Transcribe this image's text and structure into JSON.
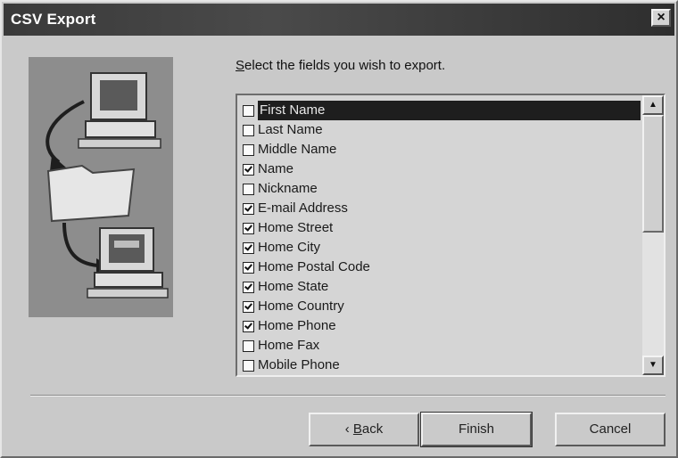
{
  "window": {
    "title": "CSV Export",
    "close_glyph": "×"
  },
  "instruction": {
    "prefix": "",
    "accel": "S",
    "rest": "elect the fields you wish to export."
  },
  "fields": [
    {
      "label": "First Name",
      "checked": false,
      "selected": true
    },
    {
      "label": "Last Name",
      "checked": false,
      "selected": false
    },
    {
      "label": "Middle Name",
      "checked": false,
      "selected": false
    },
    {
      "label": "Name",
      "checked": true,
      "selected": false
    },
    {
      "label": "Nickname",
      "checked": false,
      "selected": false
    },
    {
      "label": "E-mail Address",
      "checked": true,
      "selected": false
    },
    {
      "label": "Home Street",
      "checked": true,
      "selected": false
    },
    {
      "label": "Home City",
      "checked": true,
      "selected": false
    },
    {
      "label": "Home Postal Code",
      "checked": true,
      "selected": false
    },
    {
      "label": "Home State",
      "checked": true,
      "selected": false
    },
    {
      "label": "Home Country",
      "checked": true,
      "selected": false
    },
    {
      "label": "Home Phone",
      "checked": true,
      "selected": false
    },
    {
      "label": "Home Fax",
      "checked": false,
      "selected": false
    },
    {
      "label": "Mobile Phone",
      "checked": false,
      "selected": false
    }
  ],
  "scrollbar": {
    "up_glyph": "▲",
    "down_glyph": "▼"
  },
  "buttons": {
    "back_prefix": "‹ ",
    "back_accel": "B",
    "back_rest": "ack",
    "finish": "Finish",
    "cancel": "Cancel"
  }
}
